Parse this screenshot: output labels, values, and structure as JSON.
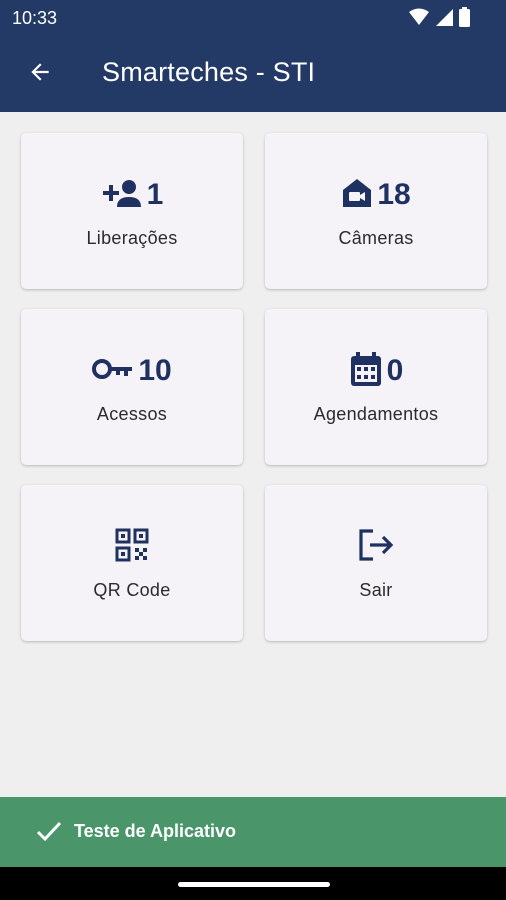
{
  "status_bar": {
    "time": "10:33",
    "icons": [
      "wifi-icon",
      "signal-icon",
      "battery-icon"
    ]
  },
  "app_bar": {
    "title": "Smarteches - STI",
    "back_icon": "arrow-back-icon"
  },
  "cards": [
    {
      "name": "liberacoes",
      "icon": "person-add-icon",
      "count": "1",
      "label": "Liberações"
    },
    {
      "name": "cameras",
      "icon": "home-camera-icon",
      "count": "18",
      "label": "Câmeras"
    },
    {
      "name": "acessos",
      "icon": "key-icon",
      "count": "10",
      "label": "Acessos"
    },
    {
      "name": "agendamentos",
      "icon": "calendar-icon",
      "count": "0",
      "label": "Agendamentos"
    },
    {
      "name": "qr-code",
      "icon": "qr-code-icon",
      "label": "QR Code"
    },
    {
      "name": "sair",
      "icon": "logout-icon",
      "label": "Sair"
    }
  ],
  "snackbar": {
    "message": "Teste de Aplicativo",
    "icon": "check-icon"
  },
  "colors": {
    "primary": "#233a66",
    "icon": "#1f3161",
    "card_bg": "#f5f2f8",
    "page_bg": "#efefef",
    "snackbar_bg": "#4a966a"
  }
}
